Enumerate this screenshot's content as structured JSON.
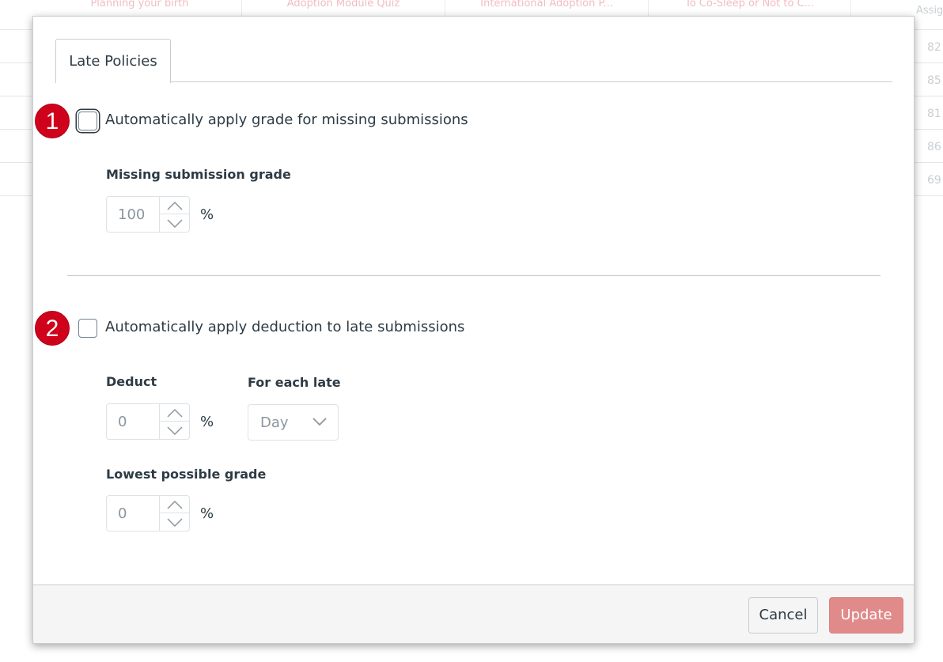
{
  "background": {
    "columns": [
      "Planning your birth",
      "Adoption Module Quiz",
      "International Adoption P...",
      "To Co-Sleep or Not to C..."
    ],
    "right_header": "Assig",
    "right_values": [
      "82",
      "85",
      "81",
      "86",
      "69"
    ]
  },
  "modal": {
    "tab_label": "Late Policies",
    "missing": {
      "badge": "1",
      "checkbox_label": "Automatically apply grade for missing submissions",
      "grade_label": "Missing submission grade",
      "grade_value": "100",
      "unit": "%"
    },
    "late": {
      "badge": "2",
      "checkbox_label": "Automatically apply deduction to late submissions",
      "deduct_label": "Deduct",
      "deduct_value": "0",
      "deduct_unit": "%",
      "interval_label": "For each late",
      "interval_value": "Day",
      "lowest_label": "Lowest possible grade",
      "lowest_value": "0",
      "lowest_unit": "%"
    },
    "footer": {
      "cancel_label": "Cancel",
      "update_label": "Update"
    }
  },
  "colors": {
    "badge": "#d0021b",
    "update_button": "#e08a8a",
    "text": "#2d3b45"
  }
}
